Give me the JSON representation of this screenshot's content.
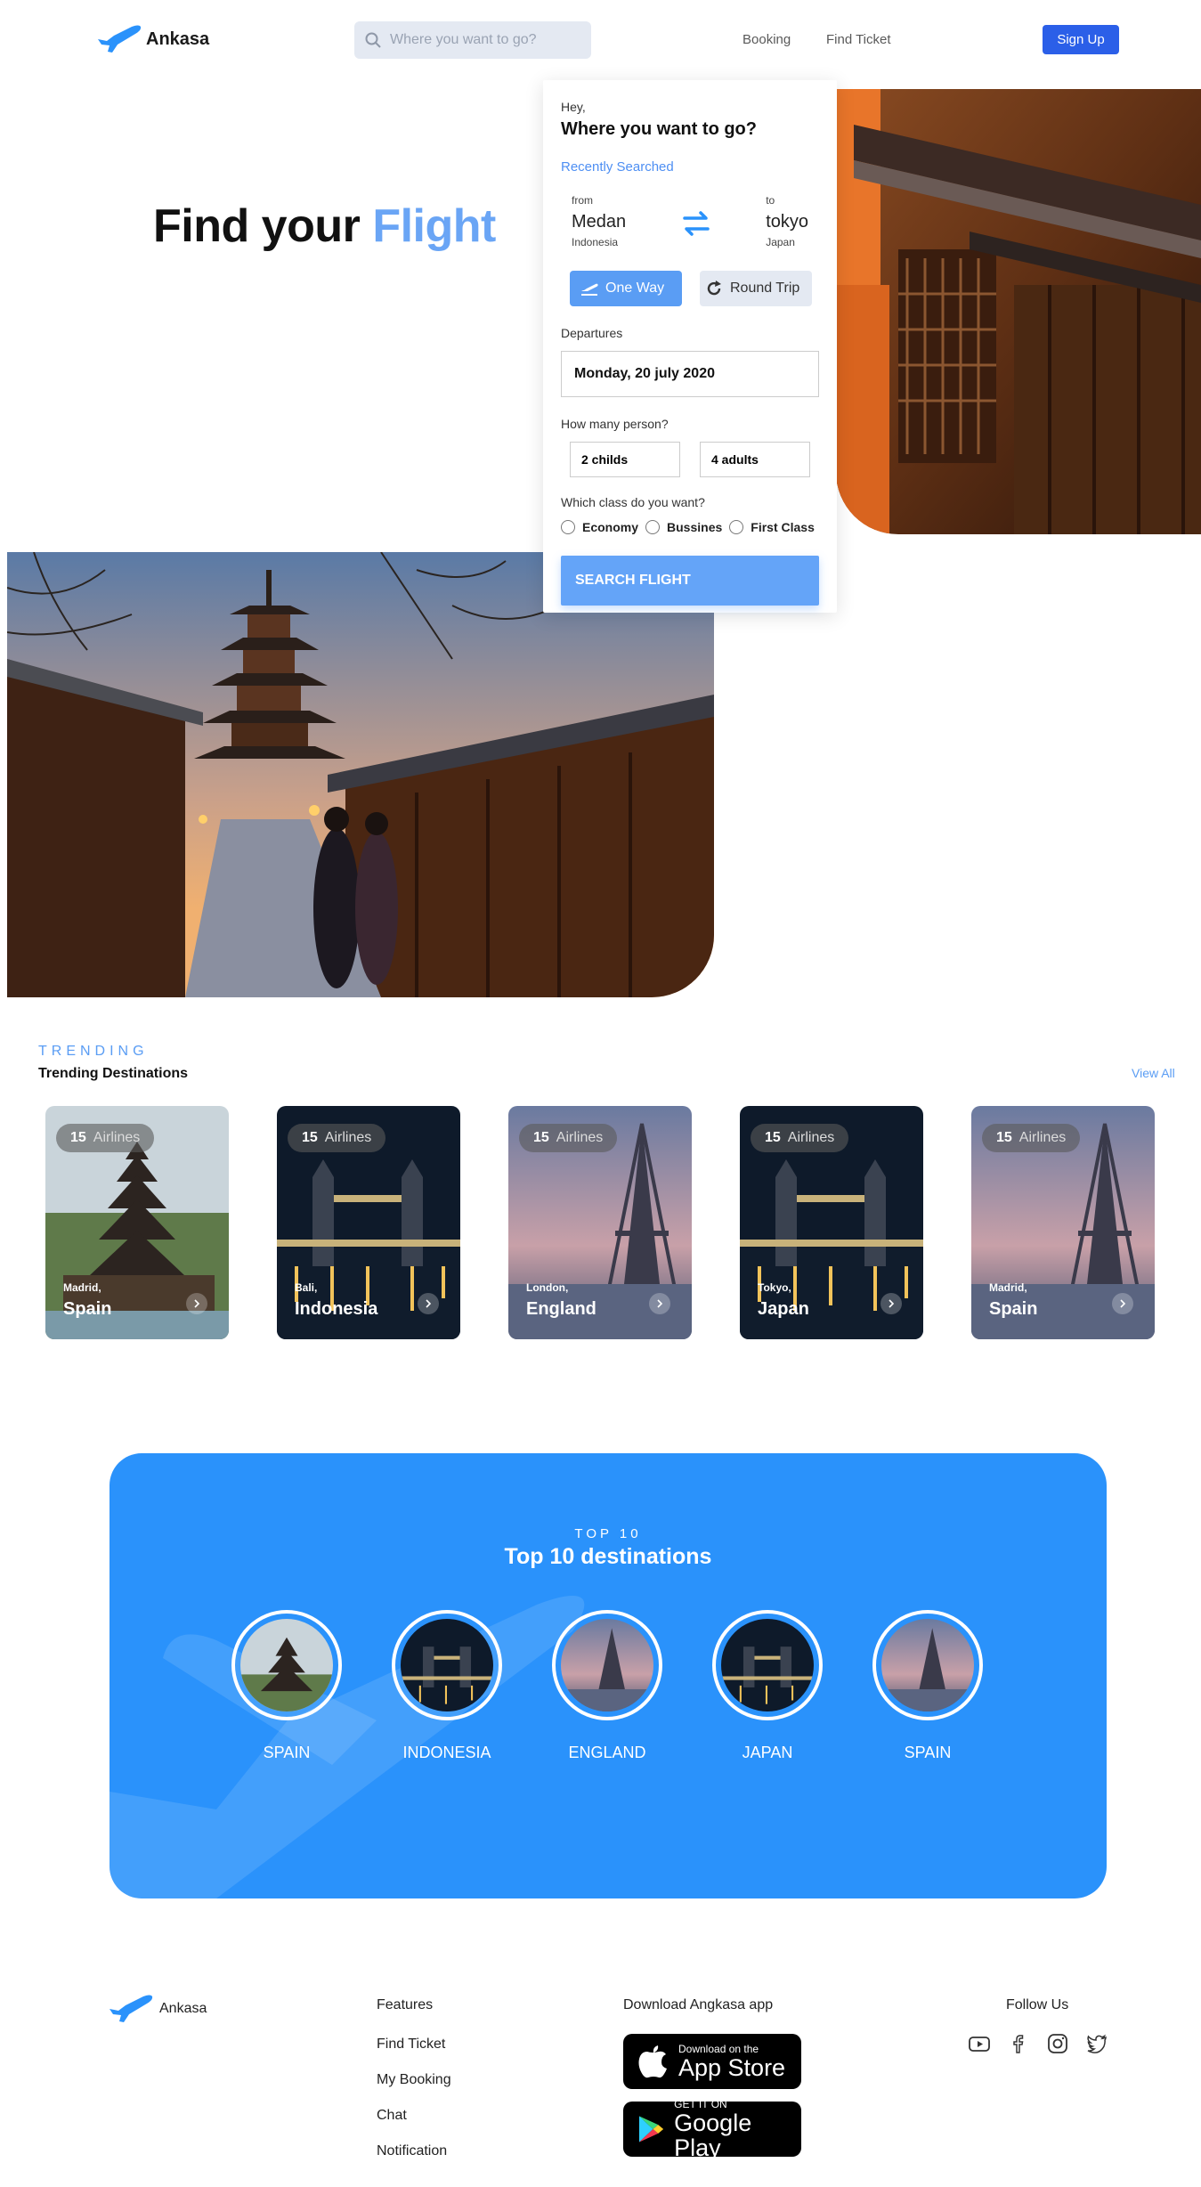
{
  "brand": {
    "name": "Ankasa",
    "accent": "#2a92fb"
  },
  "nav": {
    "search_placeholder": "Where you want to go?",
    "links": [
      "Booking",
      "Find Ticket"
    ],
    "signup": "Sign Up"
  },
  "hero": {
    "title_main": "Find your",
    "title_accent": "Flight"
  },
  "booking": {
    "greeting": "Hey,",
    "question": "Where you want to go?",
    "recent": "Recently Searched",
    "from_label": "from",
    "from_city": "Medan",
    "from_country": "Indonesia",
    "to_label": "to",
    "to_city": "tokyo",
    "to_country": "Japan",
    "one_way": "One Way",
    "round_trip": "Round Trip",
    "departures_label": "Departures",
    "departure_date": "Monday, 20 july 2020",
    "persons_label": "How many person?",
    "childs": "2 childs",
    "adults": "4 adults",
    "class_label": "Which class do you want?",
    "classes": [
      "Economy",
      "Bussines",
      "First Class"
    ],
    "submit": "SEARCH FLIGHT"
  },
  "trending": {
    "label": "TRENDING",
    "title": "Trending Destinations",
    "view_all": "View All",
    "cards": [
      {
        "count": "15",
        "airlines": "Airlines",
        "city": "Madrid,",
        "country": "Spain",
        "image": "pagoda-temple"
      },
      {
        "count": "15",
        "airlines": "Airlines",
        "city": "Bali,",
        "country": "Indonesia",
        "image": "tower-bridge-night"
      },
      {
        "count": "15",
        "airlines": "Airlines",
        "city": "London,",
        "country": "England",
        "image": "eiffel-tower-dusk"
      },
      {
        "count": "15",
        "airlines": "Airlines",
        "city": "Tokyo,",
        "country": "Japan",
        "image": "tower-bridge-night"
      },
      {
        "count": "15",
        "airlines": "Airlines",
        "city": "Madrid,",
        "country": "Spain",
        "image": "eiffel-tower-dusk"
      }
    ]
  },
  "top10": {
    "label": "TOP 10",
    "title": "Top 10 destinations",
    "items": [
      {
        "name": "SPAIN",
        "image": "pagoda-temple"
      },
      {
        "name": "INDONESIA",
        "image": "tower-bridge-night"
      },
      {
        "name": "ENGLAND",
        "image": "eiffel-tower-dusk"
      },
      {
        "name": "JAPAN",
        "image": "tower-bridge-night"
      },
      {
        "name": "SPAIN",
        "image": "eiffel-tower-dusk"
      }
    ]
  },
  "footer": {
    "brand": "Ankasa",
    "features_title": "Features",
    "features": [
      "Find Ticket",
      "My Booking",
      "Chat",
      "Notification"
    ],
    "download_title": "Download Angkasa app",
    "appstore_small": "Download on the",
    "appstore_big": "App Store",
    "googleplay_small": "GET IT ON",
    "googleplay_big": "Google Play",
    "follow_title": "Follow Us",
    "social": [
      "youtube-icon",
      "facebook-icon",
      "instagram-icon",
      "twitter-icon"
    ]
  }
}
